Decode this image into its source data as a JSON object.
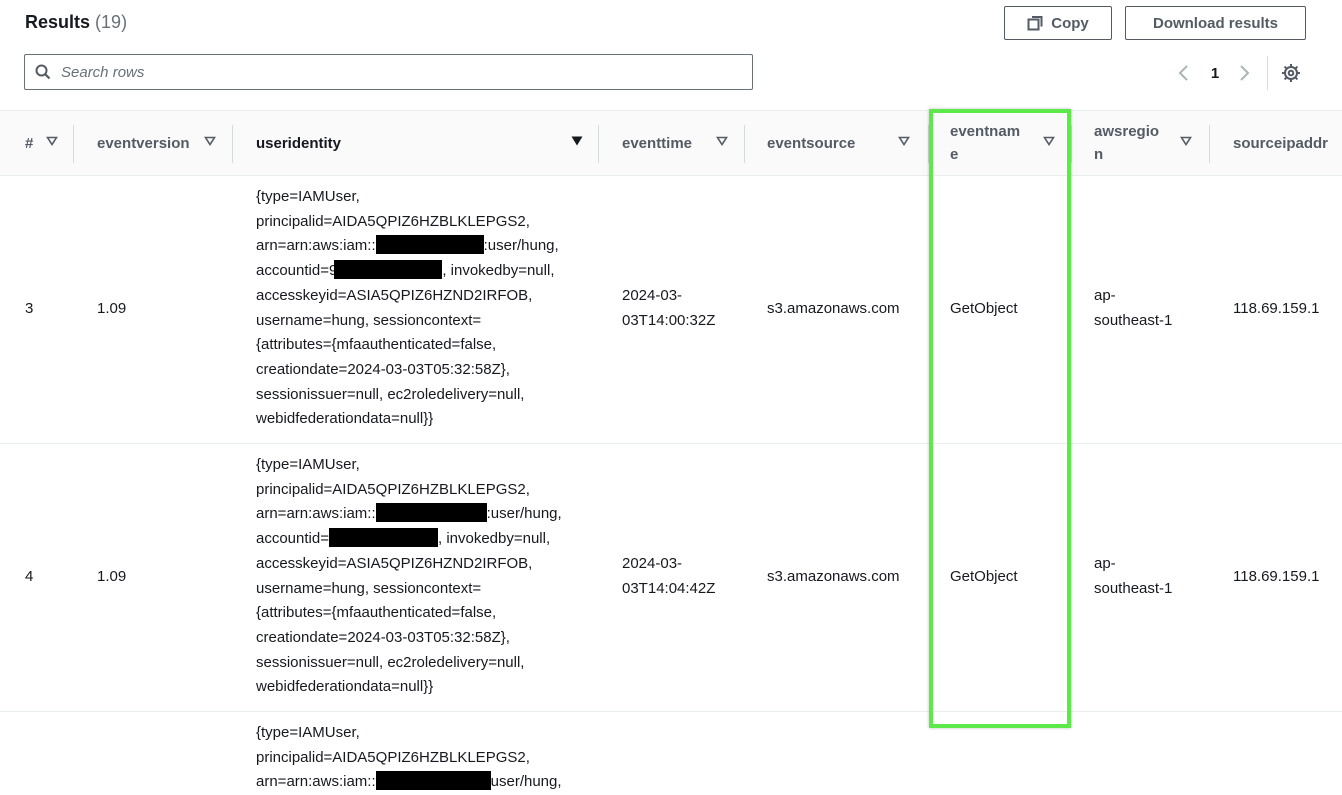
{
  "header": {
    "title": "Results",
    "count": "(19)"
  },
  "toolbar": {
    "copy_label": "Copy",
    "download_label": "Download results"
  },
  "search": {
    "placeholder": "Search rows",
    "value": ""
  },
  "pagination": {
    "current_page": "1"
  },
  "columns": {
    "index": "#",
    "eventversion": "eventversion",
    "useridentity": "useridentity",
    "eventtime": "eventtime",
    "eventsource": "eventsource",
    "eventname_1": "eventnam",
    "eventname_2": "e",
    "awsregion_1": "awsregio",
    "awsregion_2": "n",
    "sourceip": "sourceipaddr"
  },
  "rows": [
    {
      "index": "3",
      "eventversion": "1.09",
      "useridentity": {
        "l1": "{type=IAMUser,",
        "l2": "principalid=AIDA5QPIZ6HZBLKLEPGS2,",
        "l3a": "arn=arn:aws:iam::",
        "l3b": ":user/hung,",
        "l4a": "accountid=9",
        "l4b": ", invokedby=null,",
        "l5": "accesskeyid=ASIA5QPIZ6HZND2IRFOB,",
        "l6": "username=hung, sessioncontext=",
        "l7": "{attributes={mfaauthenticated=false,",
        "l8": "creationdate=2024-03-03T05:32:58Z},",
        "l9": "sessionissuer=null, ec2roledelivery=null,",
        "l10": "webidfederationdata=null}}"
      },
      "eventtime_1": "2024-03-",
      "eventtime_2": "03T14:00:32Z",
      "eventsource": "s3.amazonaws.com",
      "eventname": "GetObject",
      "awsregion_1": "ap-",
      "awsregion_2": "southeast-1",
      "sourceip": "118.69.159.1"
    },
    {
      "index": "4",
      "eventversion": "1.09",
      "useridentity": {
        "l1": "{type=IAMUser,",
        "l2": "principalid=AIDA5QPIZ6HZBLKLEPGS2,",
        "l3a": "arn=arn:aws:iam::",
        "l3b": ":user/hung,",
        "l4a": "accountid=",
        "l4b": ", invokedby=null,",
        "l5": "accesskeyid=ASIA5QPIZ6HZND2IRFOB,",
        "l6": "username=hung, sessioncontext=",
        "l7": "{attributes={mfaauthenticated=false,",
        "l8": "creationdate=2024-03-03T05:32:58Z},",
        "l9": "sessionissuer=null, ec2roledelivery=null,",
        "l10": "webidfederationdata=null}}"
      },
      "eventtime_1": "2024-03-",
      "eventtime_2": "03T14:04:42Z",
      "eventsource": "s3.amazonaws.com",
      "eventname": "GetObject",
      "awsregion_1": "ap-",
      "awsregion_2": "southeast-1",
      "sourceip": "118.69.159.1"
    },
    {
      "useridentity": {
        "l1": "{type=IAMUser,",
        "l2": "principalid=AIDA5QPIZ6HZBLKLEPGS2,",
        "l3a": "arn=arn:aws:iam::",
        "l3b": "user/hung,"
      }
    }
  ],
  "colors": {
    "highlight": "#5ee94b",
    "text": "#16191f",
    "muted": "#545b64"
  }
}
